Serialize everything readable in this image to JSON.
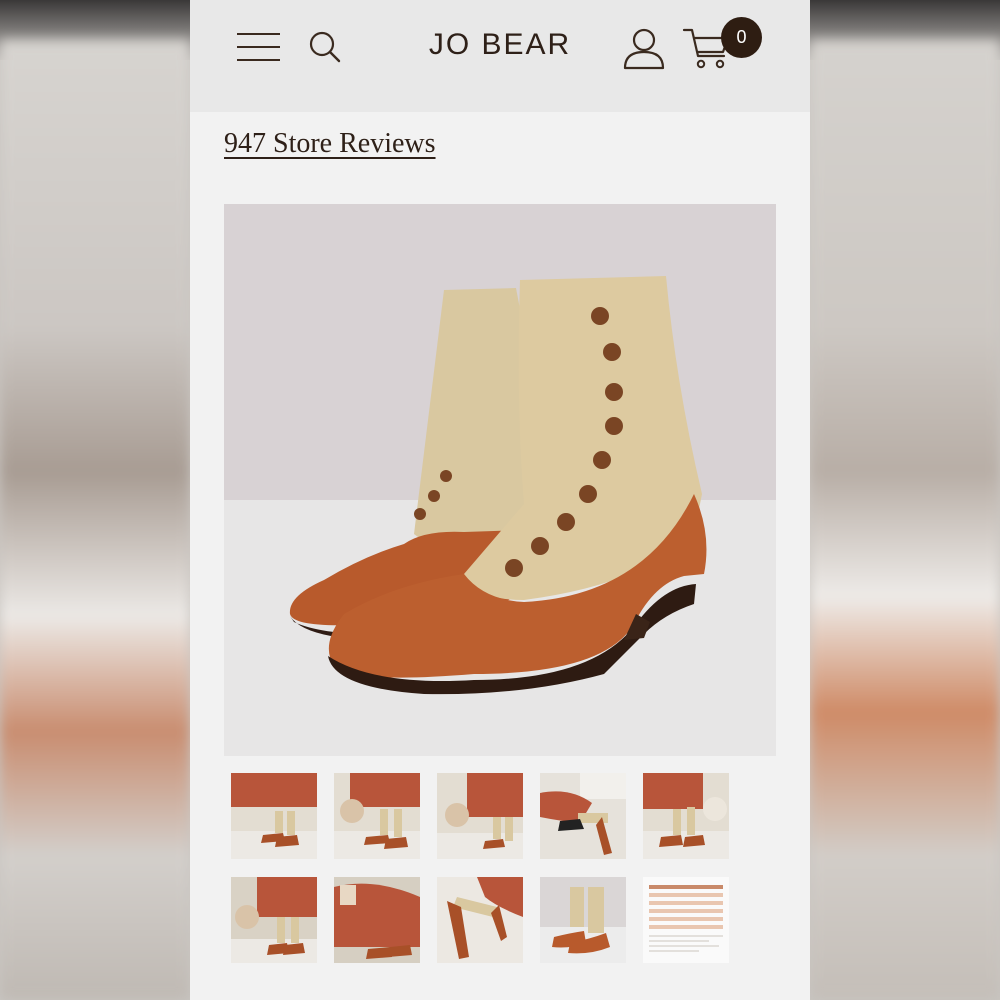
{
  "header": {
    "brand": "JO BEAR",
    "cart_count": "0",
    "icons": [
      "hamburger-menu-icon",
      "search-icon",
      "account-icon",
      "cart-icon"
    ]
  },
  "reviews": {
    "link_text": "947 Store Reviews"
  },
  "product": {
    "hero_image": "button-up-boot-suede-leather",
    "thumbnails": [
      "boots-worn-skirt-1",
      "boots-worn-skirt-2",
      "boots-worn-skirt-3",
      "boots-worn-seated",
      "boots-worn-skirt-4",
      "boots-worn-skirt-5",
      "boots-worn-seated-2",
      "boots-worn-lying",
      "boots-pair-studio",
      "size-chart"
    ]
  },
  "colors": {
    "header_bg": "#e8e8e8",
    "page_bg": "#f2f2f2",
    "brand_text": "#2e2018",
    "badge_bg": "#2e1d12",
    "leather": "#b85a2c",
    "suede": "#d9c8a0",
    "button": "#7a4524"
  }
}
